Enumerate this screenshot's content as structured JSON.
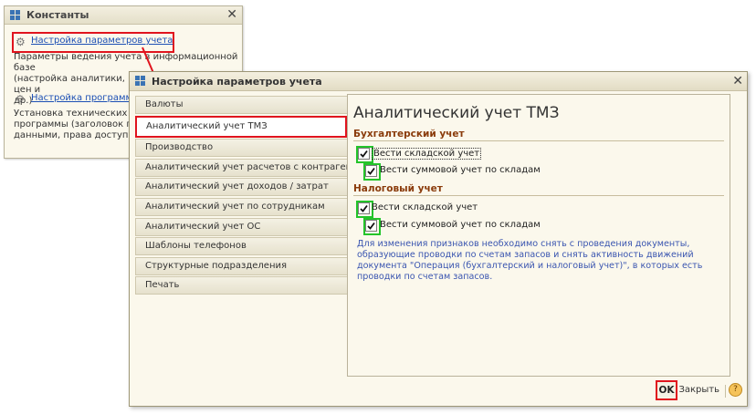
{
  "back_window": {
    "title": "Константы",
    "items": [
      {
        "link": "Настройка параметров учета",
        "desc": [
          "Параметры ведения учета в информационной базе",
          "(настройка аналитики, выбор типа плановых цен и",
          "др.)"
        ]
      },
      {
        "link": "Настройка программы",
        "desc": [
          "Установка технических пар",
          "программы (заголовок глав",
          "данными, права доступа и д"
        ]
      }
    ]
  },
  "dialog": {
    "title": "Настройка параметров учета",
    "tabs": [
      "Валюты",
      "Аналитический учет ТМЗ",
      "Производство",
      "Аналитический учет расчетов с контрагентами",
      "Аналитический учет доходов / затрат",
      "Аналитический учет по сотрудникам",
      "Аналитический учет ОС",
      "Шаблоны телефонов",
      "Структурные подразделения",
      "Печать"
    ],
    "active_tab": "Аналитический учет ТМЗ",
    "panel": {
      "heading": "Аналитический учет ТМЗ",
      "section_accounting": "Бухгалтерский учет",
      "section_tax": "Налоговый учет",
      "cb_acc_warehouse": "Вести складской учет",
      "cb_acc_sum": "Вести суммовой учет по складам",
      "cb_tax_warehouse": "Вести складской учет",
      "cb_tax_sum": "Вести суммовой учет по складам",
      "note": "Для изменения признаков необходимо снять с проведения документы, образующие проводки по счетам запасов и снять активность движений документа \"Операция (бухгалтерский и налоговый учет)\", в которых есть проводки по счетам запасов."
    },
    "buttons": {
      "ok": "OK",
      "close": "Закрыть",
      "help": "?"
    }
  },
  "colors": {
    "highlight_red": "#e0141e",
    "highlight_green": "#23c42a",
    "link_blue": "#1c4fb4",
    "section_brown": "#8a3b0b"
  }
}
